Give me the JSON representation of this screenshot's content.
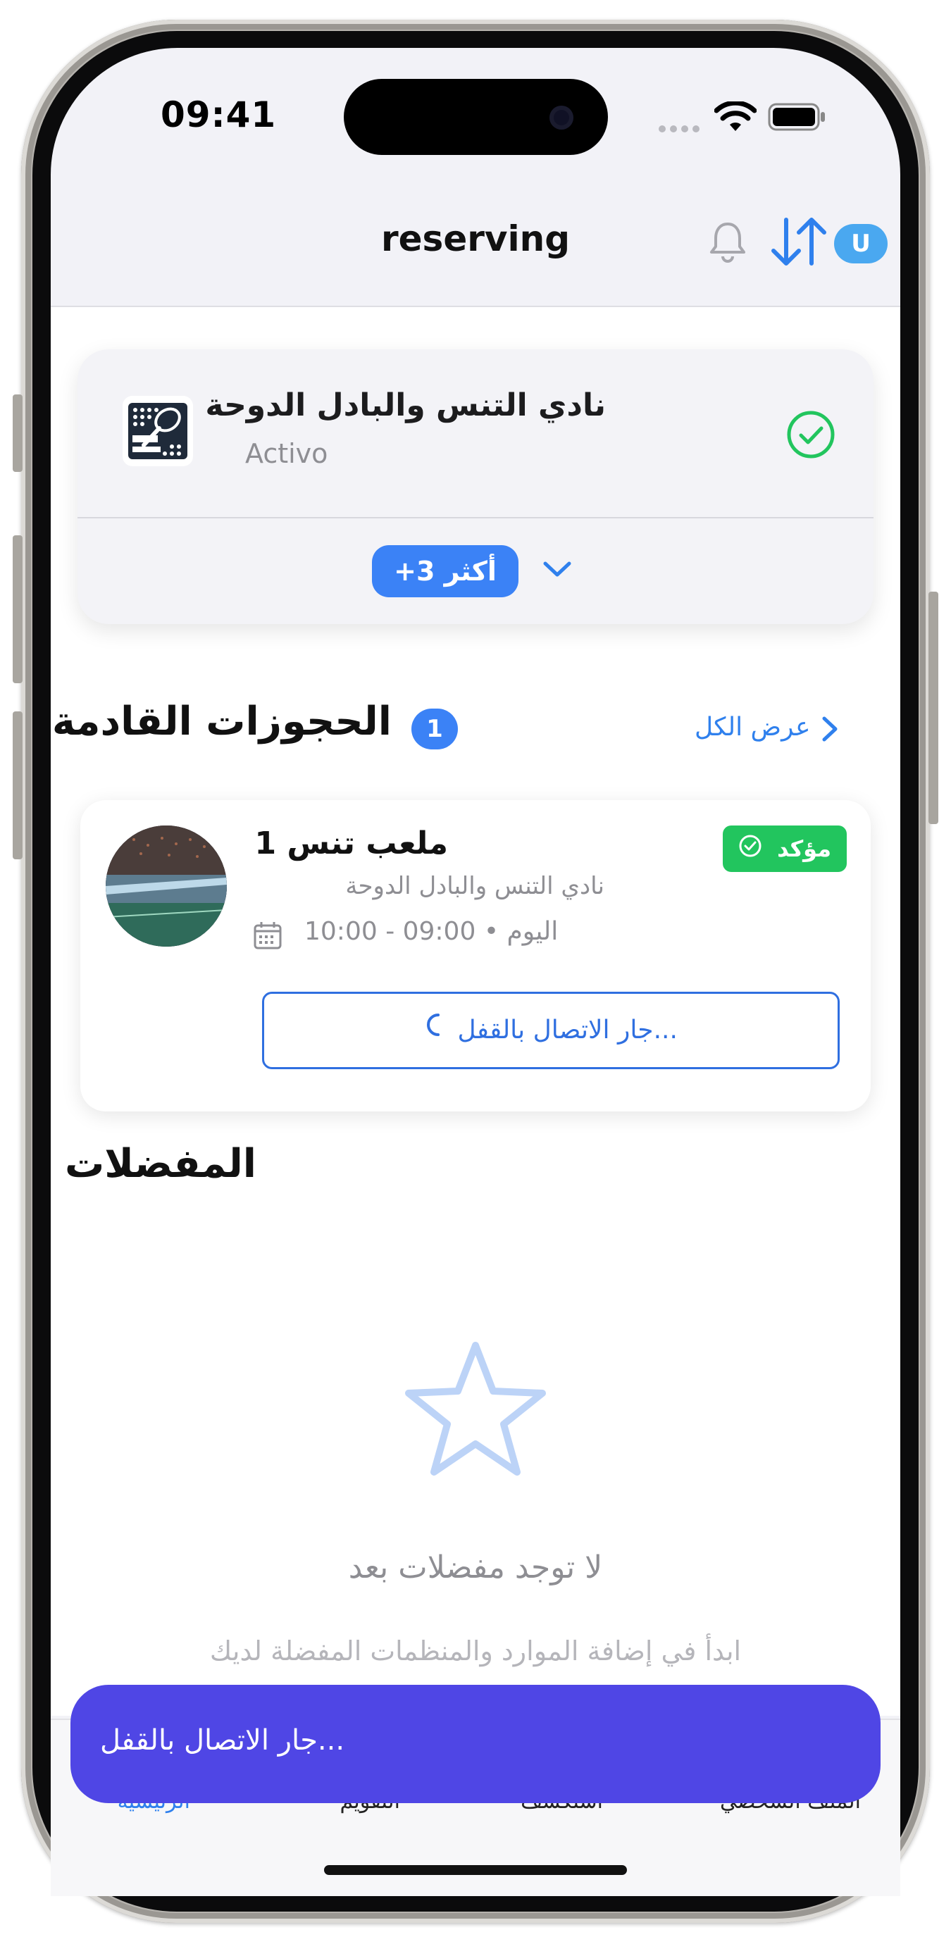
{
  "status_bar": {
    "time": "09:41"
  },
  "header": {
    "title": "reserving",
    "avatar_letter": "U"
  },
  "org_card": {
    "name": "نادي التنس والبادل الدوحة",
    "status": "Activo",
    "more_label": "أكثر 3+"
  },
  "upcoming": {
    "title": "الحجوزات القادمة",
    "count": "1",
    "see_all": "عرض الكل",
    "booking": {
      "status_badge": "مؤكد",
      "court_name": "ملعب تنس 1",
      "club_name": "نادي التنس والبادل الدوحة",
      "time_range": "10:00 - 09:00",
      "day": "اليوم",
      "lock_button": "...جار الاتصال بالقفل"
    }
  },
  "favorites": {
    "title": "المفضلات",
    "empty_title": "لا توجد مفضلات بعد",
    "empty_subtitle": "ابدأ في إضافة الموارد والمنظمات المفضلة لديك"
  },
  "tabbar": {
    "items": [
      {
        "label": "الرئيسية",
        "active": true
      },
      {
        "label": "التقويم",
        "active": false
      },
      {
        "label": "استكشف",
        "active": false
      },
      {
        "label": "الملف الشخصي",
        "active": false
      }
    ]
  },
  "toast": {
    "message": "...جار الاتصال بالقفل"
  },
  "colors": {
    "accent": "#3b82f6",
    "success": "#22c55e",
    "toast": "#4f46e5"
  }
}
